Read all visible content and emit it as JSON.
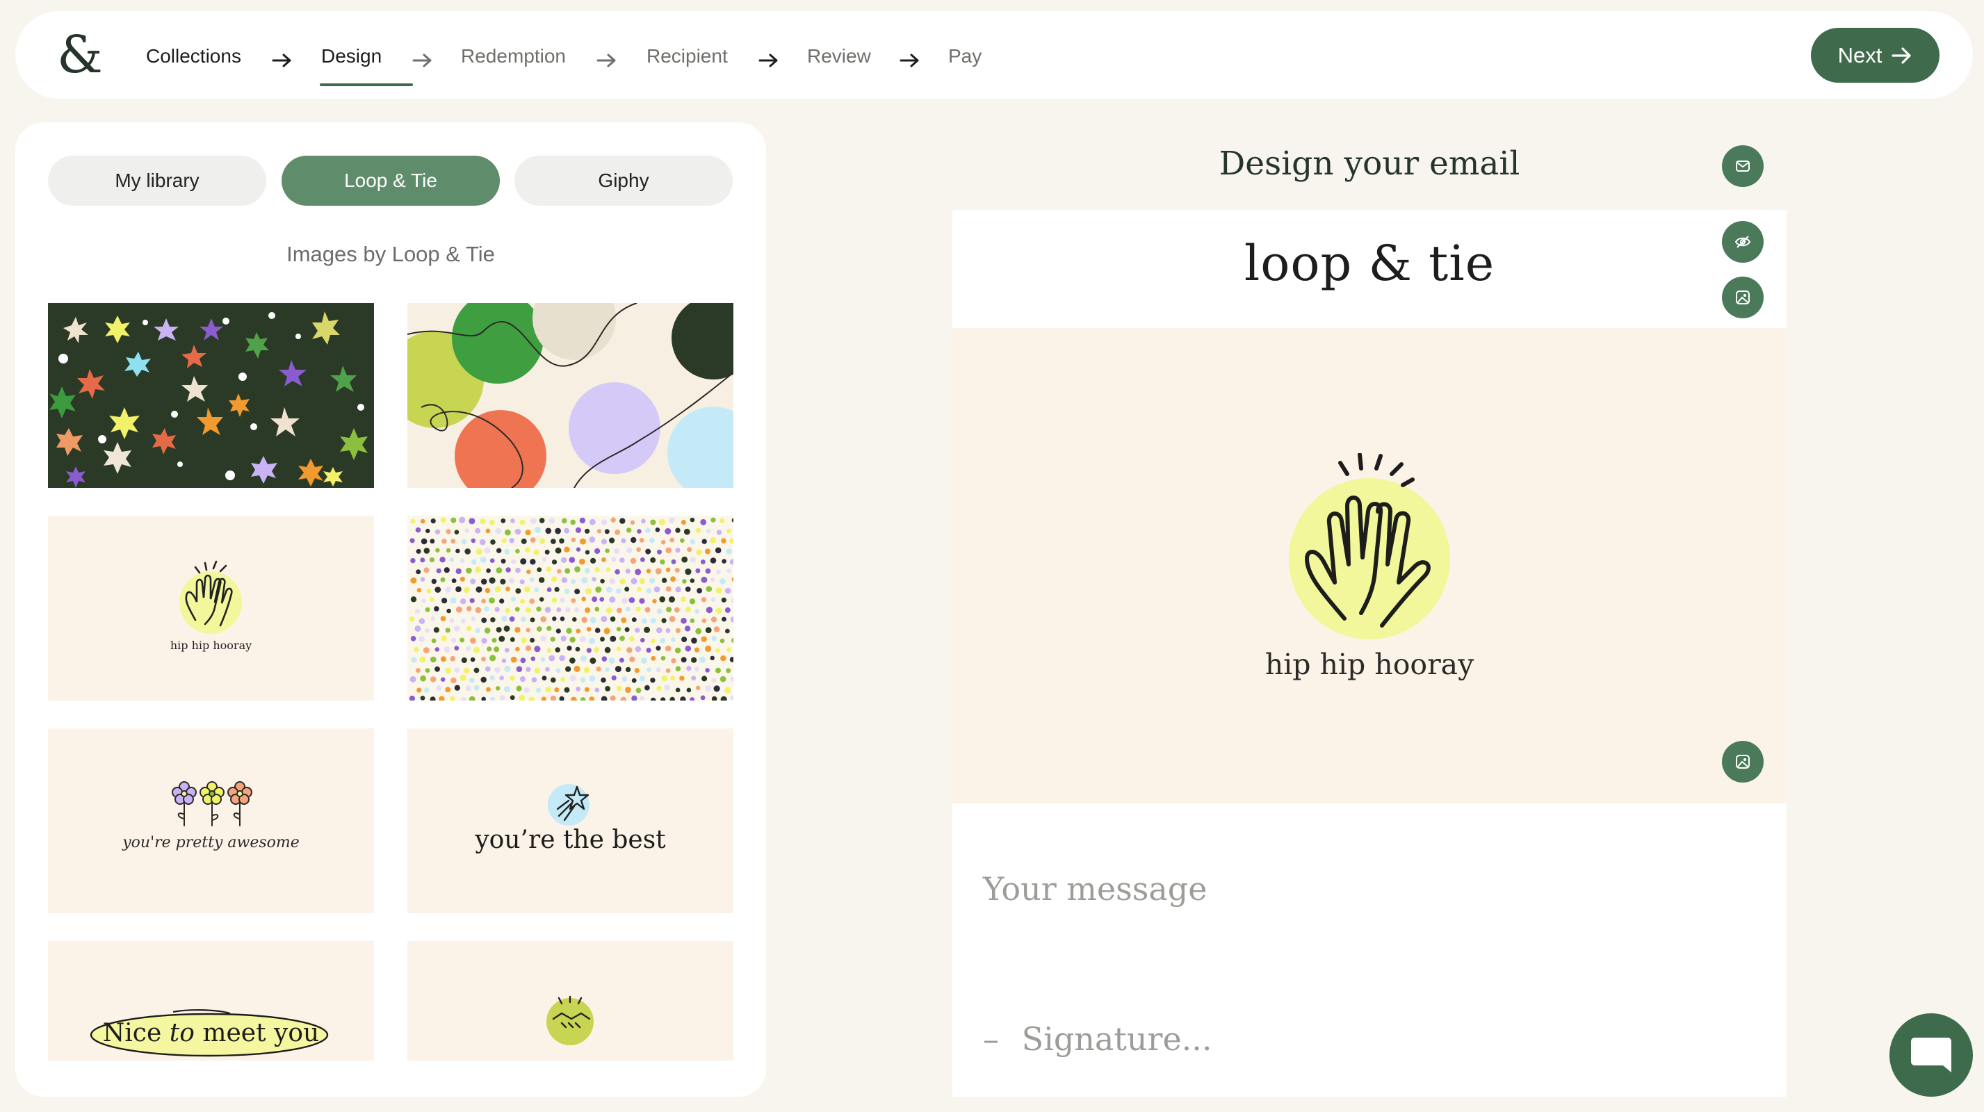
{
  "logo": {
    "glyph": "&"
  },
  "steps": [
    {
      "label": "Collections",
      "state": "done"
    },
    {
      "label": "Design",
      "state": "active"
    },
    {
      "label": "Redemption",
      "state": "upcoming"
    },
    {
      "label": "Recipient",
      "state": "upcoming"
    },
    {
      "label": "Review",
      "state": "upcoming"
    },
    {
      "label": "Pay",
      "state": "upcoming"
    }
  ],
  "header": {
    "next_label": "Next",
    "next_icon": "arrow-right-icon"
  },
  "library": {
    "tabs": [
      {
        "label": "My library",
        "active": false
      },
      {
        "label": "Loop & Tie",
        "active": true
      },
      {
        "label": "Giphy",
        "active": false
      }
    ],
    "section_title": "Images by Loop & Tie",
    "cards": [
      {
        "name": "star-confetti-dark"
      },
      {
        "name": "colorful-circles"
      },
      {
        "name": "hip-hip-hooray",
        "caption": "hip hip hooray"
      },
      {
        "name": "polka-dots"
      },
      {
        "name": "pretty-awesome-flowers",
        "caption": "you're pretty awesome"
      },
      {
        "name": "youre-the-best",
        "caption": "you’re the best"
      },
      {
        "name": "nice-to-meet-you",
        "caption_a": "Nice",
        "caption_b": "to",
        "caption_c": "meet you"
      },
      {
        "name": "welcome-to-the-team"
      }
    ]
  },
  "editor": {
    "title": "Design your email",
    "brand": "loop & tie",
    "hero_caption": "hip hip hooray",
    "message_placeholder": "Your message",
    "signature_dash": "–",
    "signature_placeholder": "Signature...",
    "icons": [
      "email-icon",
      "hide-icon",
      "image-icon",
      "image-icon"
    ]
  },
  "colors": {
    "accent": "#3f6b4c",
    "tab_active": "#5f8c6b",
    "page_bg": "#f8f5ee",
    "card_bg": "#fcf3e8",
    "yellow": "#f1f79a"
  },
  "chat": {
    "icon": "chat-bubble-icon"
  }
}
